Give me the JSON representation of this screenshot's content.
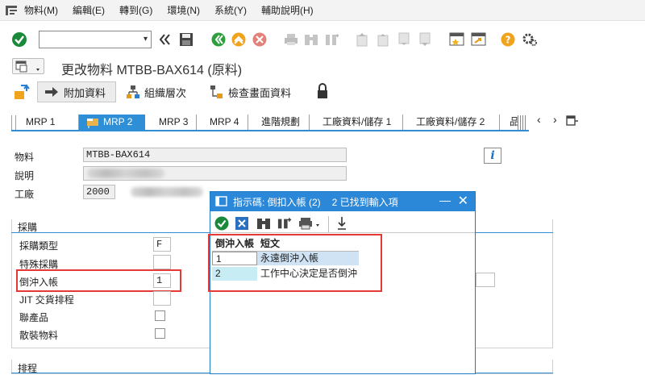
{
  "menubar": {
    "items": [
      "物料(M)",
      "編輯(E)",
      "轉到(G)",
      "環境(N)",
      "系統(Y)",
      "輔助說明(H)"
    ]
  },
  "toolbar": {
    "icons": [
      "enter-icon",
      "back-icon",
      "save-icon",
      "back-green-icon",
      "exit-icon",
      "cancel-icon",
      "print-icon",
      "find-icon",
      "find-next-icon",
      "first-page-icon",
      "prev-page-icon",
      "next-page-icon",
      "last-page-icon",
      "new-session-icon",
      "shortcut-icon",
      "help-icon",
      "customize-icon"
    ]
  },
  "title": {
    "text": "更改物料 MTBB-BAX614 (原料)"
  },
  "app_toolbar": {
    "additional_data": "附加資料",
    "org_levels": "組織層次",
    "check_screen_data": "檢查畫面資料"
  },
  "tabs": [
    {
      "label": "MRP 1",
      "active": false
    },
    {
      "label": "MRP 2",
      "active": true
    },
    {
      "label": "MRP 3",
      "active": false
    },
    {
      "label": "MRP 4",
      "active": false
    },
    {
      "label": "進階規劃",
      "active": false
    },
    {
      "label": "工廠資料/儲存 1",
      "active": false
    },
    {
      "label": "工廠資料/儲存 2",
      "active": false
    },
    {
      "label": "品",
      "active": false
    }
  ],
  "header_fields": {
    "material_label": "物料",
    "material_value": "MTBB-BAX614",
    "description_label": "說明",
    "plant_label": "工廠",
    "plant_value": "2000"
  },
  "procurement": {
    "title": "採購",
    "procurement_type_label": "採購類型",
    "procurement_type_value": "F",
    "special_procurement_label": "特殊採購",
    "backflush_label": "倒沖入帳",
    "backflush_value": "1",
    "jit_label": "JIT 交貨排程",
    "co_product_label": "聯產品",
    "bulk_material_label": "散裝物料"
  },
  "scheduling": {
    "title": "排程"
  },
  "popup": {
    "title": "指示碼: 倒扣入帳 (2)",
    "hits": "2 已找到輸入項",
    "col_key": "倒沖入帳",
    "col_text": "短文",
    "rows": [
      {
        "key": "1",
        "text": "永遠倒沖入帳"
      },
      {
        "key": "2",
        "text": "工作中心決定是否倒沖"
      }
    ]
  },
  "colors": {
    "accent": "#2f8fd6",
    "highlight": "#e53935",
    "row_selected": "#cfe3f4",
    "row_alt": "#c7ecf3"
  }
}
